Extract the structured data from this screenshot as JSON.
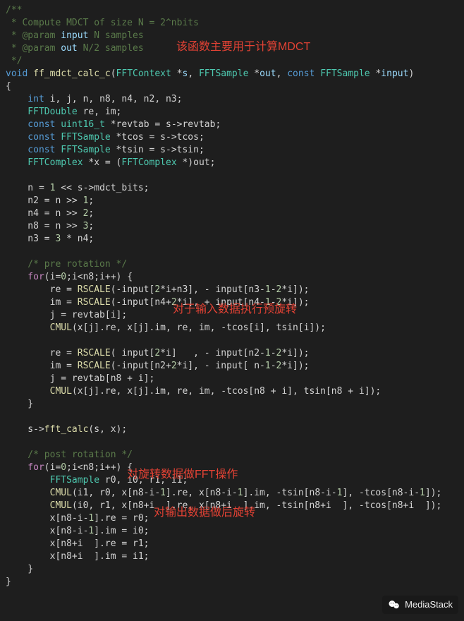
{
  "comment": {
    "l1": "/**",
    "l2": " * Compute MDCT of size N = 2^nbits",
    "l3a": " * @param ",
    "l3b": "input",
    "l3c": " N samples",
    "l4a": " * @param ",
    "l4b": "out",
    "l4c": " N/2 samples",
    "l5": " */"
  },
  "sig": {
    "void": "void",
    "fn": "ff_mdct_calc_c",
    "lp": "(",
    "t1": "FFTContext",
    "p1": " *",
    "a1": "s",
    "c1": ", ",
    "t2": "FFTSample",
    "p2": " *",
    "a2": "out",
    "c2": ", ",
    "const": "const",
    "sp": " ",
    "t3": "FFTSample",
    "p3": " *",
    "a3": "input",
    "rp": ")"
  },
  "brace_open": "{",
  "decl": {
    "int": "    int",
    "intvars": " i, j, n, n8, n4, n2, n3;",
    "fftd": "    FFTDouble",
    "reim": " re, im;",
    "const1a": "    const",
    "u16": " uint16_t",
    "revtab": " *revtab = s->revtab;",
    "const2a": "    const",
    "ffts2": " FFTSample",
    "tcos": " *tcos = s->tcos;",
    "const3a": "    const",
    "ffts3": " FFTSample",
    "tsin": " *tsin = s->tsin;",
    "fftc": "    FFTComplex",
    "xcast1": " *x = (",
    "fftc2": "FFTComplex",
    "xcast2": " *)out;"
  },
  "init": {
    "n_a": "    n = ",
    "n_b": "1",
    "n_c": " << s->mdct_bits;",
    "n2a": "    n2 = n >> ",
    "n2b": "1",
    "n2c": ";",
    "n4a": "    n4 = n >> ",
    "n4b": "2",
    "n4c": ";",
    "n8a": "    n8 = n >> ",
    "n8b": "3",
    "n8c": ";",
    "n3a": "    n3 = ",
    "n3b": "3",
    "n3c": " * n4;"
  },
  "pre_cmt": "    /* pre rotation */",
  "pre_loop": {
    "for": "    for",
    "head_a": "(i=",
    "z1": "0",
    "head_b": ";i<n8;i++) {",
    "re1a": "        re = ",
    "RS": "RSCALE",
    "re1b": "(-input[",
    "two": "2",
    "re1c": "*i+n3], - input[n3-",
    "one": "1",
    "re1d": "-",
    "re1e": "*i]);",
    "im1a": "        im = ",
    "im1b": "(-input[n4+",
    "im1c": "*i], + input[n4-",
    "im1d": "-",
    "im1e": "*i]);",
    "j1": "        j = revtab[i];",
    "cmul": "CMUL",
    "cmul1a": "        ",
    "cmul1b": "(x[j].re, x[j].im, re, im, -tcos[i], tsin[i]);",
    "re2a": "        re = ",
    "re2b": "( input[",
    "re2c": "*i]   , - input[n2-",
    "re2d": "-",
    "re2e": "*i]);",
    "im2a": "        im = ",
    "im2b": "(-input[n2+",
    "im2c": "*i], - input[ n-",
    "im2d": "-",
    "im2e": "*i]);",
    "j2": "        j = revtab[n8 + i];",
    "cmul2a": "        ",
    "cmul2b": "(x[j].re, x[j].im, re, im, -tcos[n8 + i], tsin[n8 + i]);",
    "close": "    }"
  },
  "fftcall": {
    "a": "    s->",
    "fn": "fft_calc",
    "b": "(s, x);"
  },
  "post_cmt": "    /* post rotation */",
  "post_loop": {
    "for": "    for",
    "head_a": "(i=",
    "z1": "0",
    "head_b": ";i<n8;i++) {",
    "sampdecl_a": "        ",
    "sampdecl_t": "FFTSample",
    "sampdecl_b": " r0, i0, r1, i1;",
    "cmul": "CMUL",
    "c1a": "        ",
    "c1b": "(i1, r0, x[n8-i-",
    "one": "1",
    "c1c": "].re, x[n8-i-",
    "c1d": "].im, -tsin[n8-i-",
    "c1e": "], -tcos[n8-i-",
    "c1f": "]);",
    "c2a": "        ",
    "c2b": "(i0, r1, x[n8+i  ].re, x[n8+i  ].im, -tsin[n8+i  ], -tcos[n8+i  ]);",
    "x1": "        x[n8-i-",
    "x1b": "].re = r0;",
    "x2": "        x[n8-i-",
    "x2b": "].im = i0;",
    "x3": "        x[n8+i  ].re = r1;",
    "x4": "        x[n8+i  ].im = i1;",
    "close": "    }"
  },
  "brace_close": "}",
  "annotations": {
    "a1": "该函数主要用于计算MDCT",
    "a2": "对于输入数据执行预旋转",
    "a3": "对旋转数据做FFT操作",
    "a4": "对输出数据做后旋转"
  },
  "watermark": {
    "text": "MediaStack"
  }
}
